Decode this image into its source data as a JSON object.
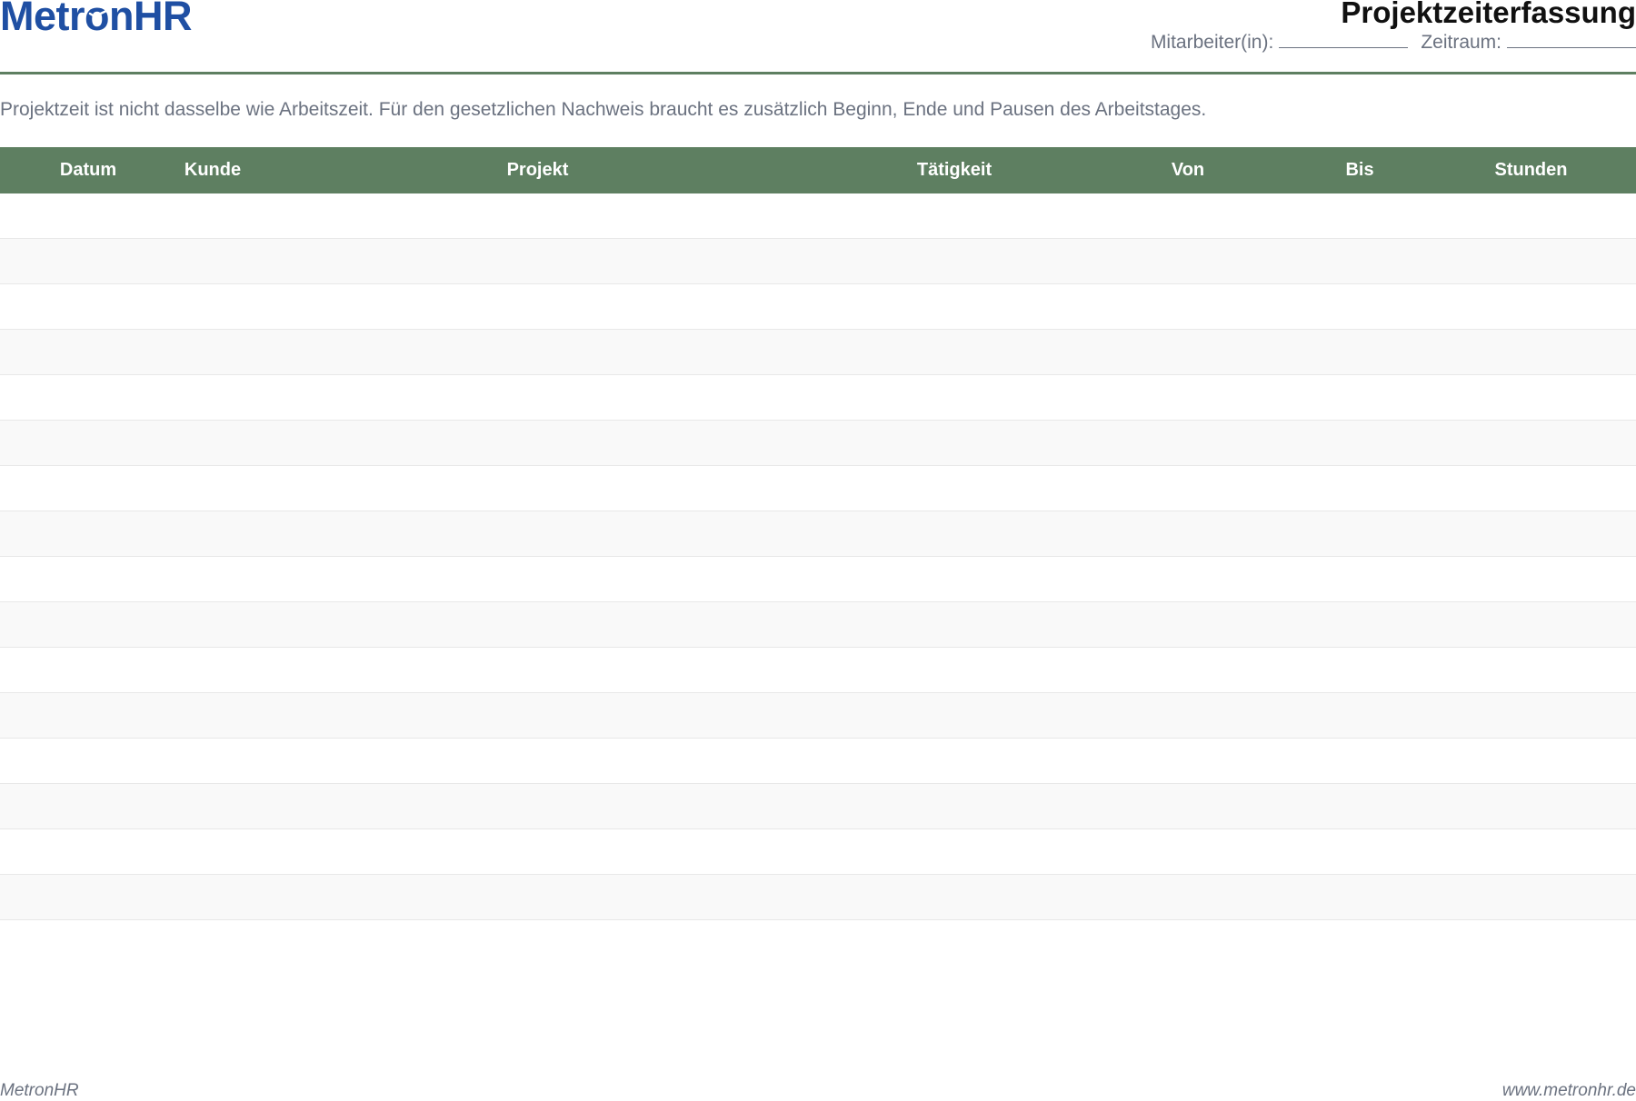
{
  "header": {
    "logo_left": "Metr",
    "logo_o": "o",
    "logo_right": "nHR",
    "title": "Projektzeiterfassung",
    "employee_label": "Mitarbeiter(in):",
    "period_label": "Zeitraum:"
  },
  "intro": "Projektzeit ist nicht dasselbe wie Arbeitszeit. Für den gesetzlichen Nachweis braucht es zusätzlich Beginn, Ende und Pausen des Arbeitstages.",
  "table": {
    "columns": [
      "Datum",
      "Kunde",
      "Projekt",
      "Tätigkeit",
      "Von",
      "Bis",
      "Stunden"
    ],
    "row_count": 16
  },
  "footer": {
    "left": "MetronHR",
    "right": "www.metronhr.de"
  },
  "colors": {
    "brand": "#1f4fa3",
    "header_green": "#5e7f61",
    "muted_text": "#6b7280"
  }
}
